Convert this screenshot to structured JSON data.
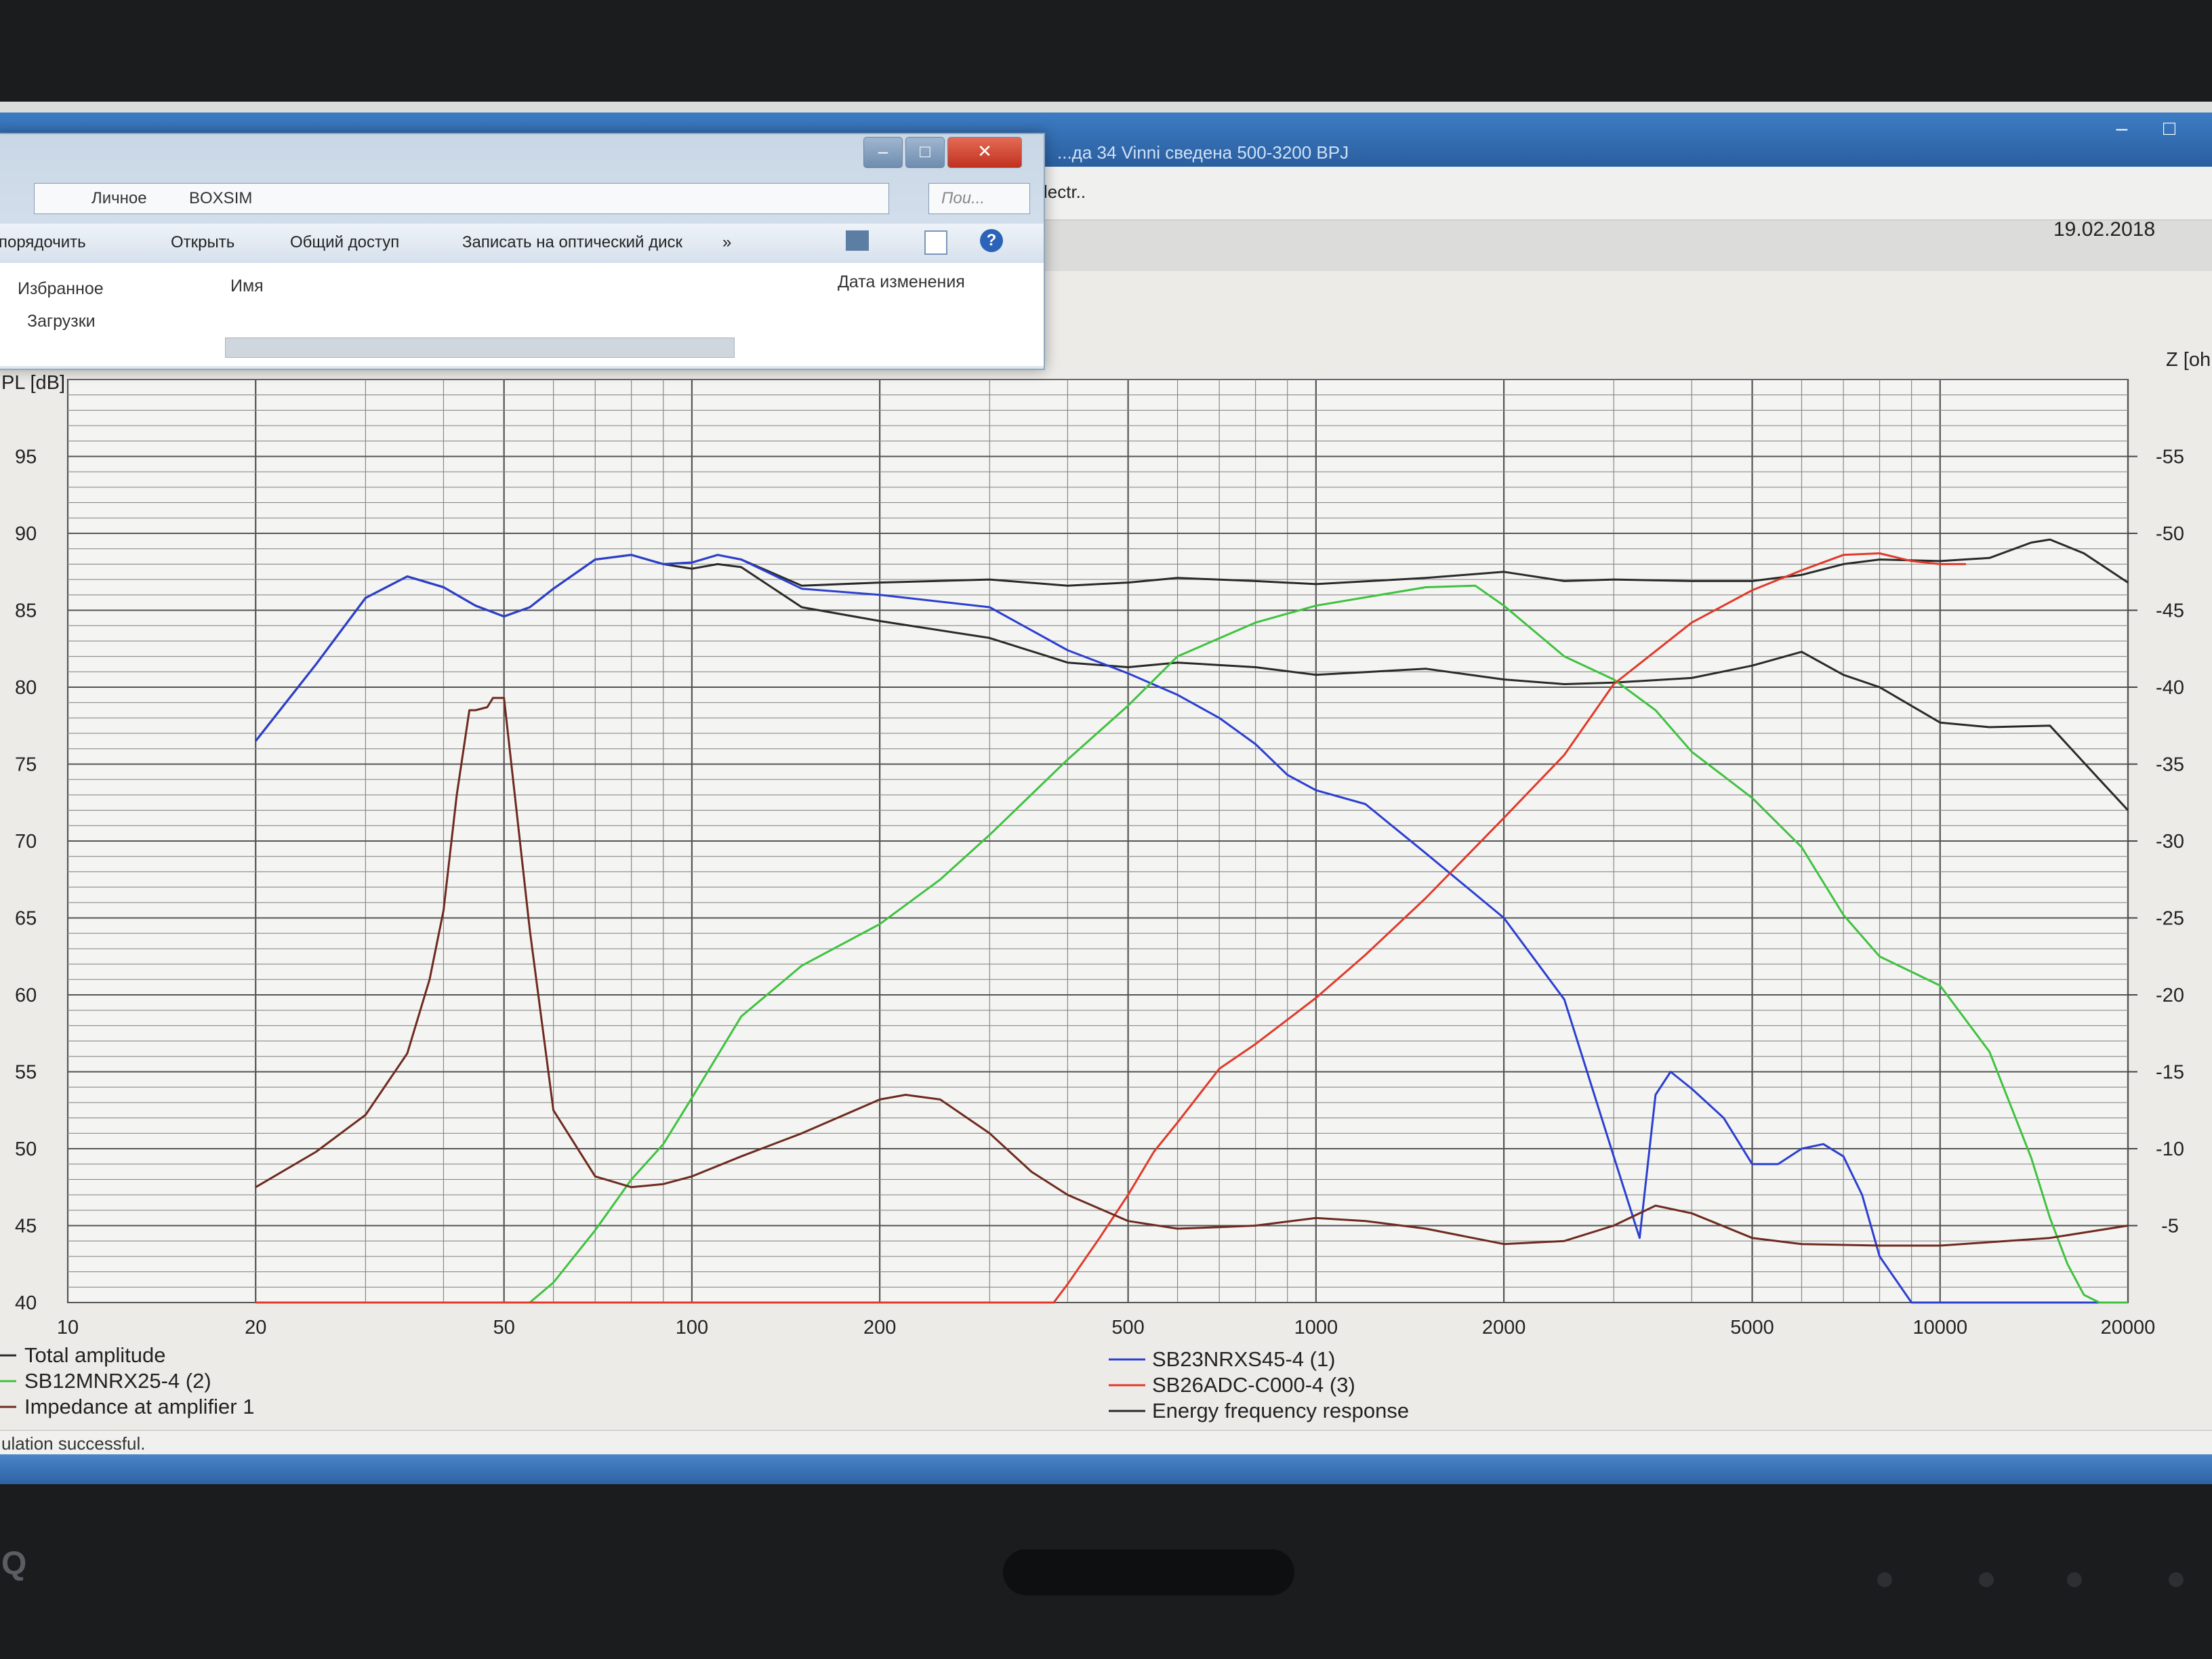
{
  "app": {
    "title": "...да 34 Vinni сведена 500-3200 BPJ",
    "menu_fragment": "lectr..",
    "status_text": "ulation successful.",
    "date": "19.02.2018"
  },
  "explorer": {
    "breadcrumb": [
      "Личное",
      "BOXSIM"
    ],
    "search_placeholder": "Пои...",
    "toolbar": {
      "organize": "порядочить",
      "open": "Открыть",
      "share": "Общий доступ",
      "burn": "Записать на оптический диск",
      "more": "»"
    },
    "nav_items": [
      "Избранное",
      "Загрузки"
    ],
    "columns": [
      "Имя",
      "Дата изменения"
    ],
    "buttons": {
      "minimize": "–",
      "maximize": "□",
      "close": "✕"
    }
  },
  "chart_data": {
    "type": "line",
    "xscale": "log",
    "xlim": [
      10,
      20000
    ],
    "ylim": [
      40,
      100
    ],
    "y2lim": [
      0,
      60
    ],
    "ylabel": "PL [dB]",
    "y2label": "Z [oh",
    "x_ticks": [
      10,
      20,
      50,
      100,
      200,
      500,
      1000,
      2000,
      5000,
      10000,
      20000
    ],
    "y_ticks": [
      40,
      45,
      50,
      55,
      60,
      65,
      70,
      75,
      80,
      85,
      90,
      95
    ],
    "y2_ticks": [
      5,
      10,
      15,
      20,
      25,
      30,
      35,
      40,
      45,
      50,
      55
    ],
    "grid": true,
    "legend": {
      "left": [
        "Total amplitude",
        "SB12MNRX25-4 (2)",
        "Impedance at amplifier 1"
      ],
      "right": [
        "SB23NRXS45-4 (1)",
        "SB26ADC-C000-4 (3)",
        "Energy frequency response"
      ]
    },
    "series": [
      {
        "name": "Total amplitude",
        "color": "#2a2a2a",
        "axis": "left",
        "x": [
          20,
          25,
          30,
          35,
          40,
          45,
          50,
          55,
          60,
          70,
          80,
          90,
          100,
          110,
          120,
          150,
          200,
          300,
          400,
          500,
          600,
          800,
          1000,
          1500,
          2000,
          2500,
          3000,
          4000,
          5000,
          6000,
          7000,
          8000,
          10000,
          12000,
          15000,
          18000,
          20000
        ],
        "y": [
          76.5,
          81.5,
          85.8,
          87.2,
          86.5,
          85.3,
          84.6,
          85.2,
          86.4,
          88.3,
          88.6,
          88,
          87.7,
          88,
          87.8,
          85.2,
          84.3,
          83.2,
          81.6,
          81.3,
          81.6,
          81.3,
          80.8,
          81.2,
          80.5,
          80.2,
          80.3,
          80.6,
          81.4,
          82.3,
          80.8,
          80,
          77.7,
          77.4,
          77.5,
          74,
          72
        ]
      },
      {
        "name": "Energy frequency response",
        "color": "#2a2a2a",
        "axis": "left",
        "x": [
          20,
          25,
          30,
          35,
          40,
          45,
          50,
          55,
          60,
          70,
          80,
          90,
          100,
          110,
          120,
          150,
          200,
          300,
          400,
          500,
          600,
          800,
          1000,
          1500,
          2000,
          2500,
          3000,
          4000,
          5000,
          6000,
          7000,
          8000,
          10000,
          12000,
          14000,
          15000,
          17000,
          20000
        ],
        "y": [
          76.5,
          81.5,
          85.8,
          87.2,
          86.5,
          85.3,
          84.6,
          85.2,
          86.4,
          88.3,
          88.6,
          88,
          88.1,
          88.6,
          88.3,
          86.6,
          86.8,
          87,
          86.6,
          86.8,
          87.1,
          86.9,
          86.7,
          87.1,
          87.5,
          86.9,
          87,
          86.9,
          86.9,
          87.3,
          88,
          88.3,
          88.2,
          88.4,
          89.4,
          89.6,
          88.7,
          86.8
        ]
      },
      {
        "name": "SB23NRXS45-4 (1)",
        "color": "#2b3fd0",
        "axis": "left",
        "x": [
          20,
          25,
          30,
          35,
          40,
          45,
          50,
          55,
          60,
          70,
          80,
          90,
          100,
          110,
          120,
          150,
          200,
          300,
          400,
          500,
          600,
          700,
          800,
          900,
          1000,
          1200,
          1500,
          2000,
          2500,
          3000,
          3300,
          3500,
          3700,
          4000,
          4500,
          5000,
          5500,
          6000,
          6500,
          7000,
          7500,
          8000,
          9000,
          10000,
          11000,
          12000,
          14000,
          16000,
          18000,
          20000
        ],
        "y": [
          76.5,
          81.5,
          85.8,
          87.2,
          86.5,
          85.3,
          84.6,
          85.2,
          86.4,
          88.3,
          88.6,
          88,
          88.1,
          88.6,
          88.3,
          86.4,
          86,
          85.2,
          82.4,
          80.9,
          79.5,
          78,
          76.3,
          74.3,
          73.3,
          72.4,
          69.2,
          65,
          59.7,
          49.5,
          44.2,
          53.5,
          55,
          53.9,
          52,
          49,
          49,
          50,
          50.3,
          49.5,
          47,
          43,
          40,
          40,
          40,
          40,
          40,
          40,
          40,
          40
        ]
      },
      {
        "name": "SB12MNRX25-4 (2)",
        "color": "#3fc23f",
        "axis": "left",
        "x": [
          20,
          55,
          60,
          70,
          80,
          90,
          100,
          120,
          150,
          200,
          250,
          300,
          400,
          500,
          600,
          800,
          1000,
          1500,
          1800,
          2000,
          2500,
          3000,
          3500,
          4000,
          5000,
          6000,
          7000,
          8000,
          9000,
          10000,
          12000,
          14000,
          15000,
          16000,
          17000,
          18000,
          20000
        ],
        "y": [
          40,
          40,
          41.3,
          44.7,
          48,
          50.3,
          53.3,
          58.6,
          61.9,
          64.6,
          67.5,
          70.4,
          75.3,
          78.8,
          82,
          84.2,
          85.3,
          86.5,
          86.6,
          85.3,
          82,
          80.5,
          78.5,
          75.8,
          72.8,
          69.6,
          65.2,
          62.5,
          61.5,
          60.6,
          56.3,
          49.4,
          45.5,
          42.5,
          40.5,
          40,
          40
        ]
      },
      {
        "name": "SB26ADC-C000-4 (3)",
        "color": "#e03a2a",
        "axis": "left",
        "x": [
          20,
          380,
          400,
          450,
          500,
          550,
          600,
          700,
          800,
          1000,
          1200,
          1500,
          2000,
          2500,
          3000,
          4000,
          5000,
          6000,
          7000,
          8000,
          9000,
          10000,
          11000
        ],
        "y": [
          40,
          40,
          41.2,
          44.2,
          47,
          49.8,
          51.7,
          55.2,
          56.8,
          59.8,
          62.6,
          66.3,
          71.5,
          75.6,
          80.2,
          84.2,
          86.3,
          87.6,
          88.6,
          88.7,
          88.2,
          88,
          88
        ]
      },
      {
        "name": "Impedance at amplifier 1",
        "color": "#6e2a1e",
        "axis": "right",
        "x": [
          20,
          25,
          30,
          35,
          38,
          40,
          42,
          44,
          45,
          47,
          48,
          50,
          55,
          60,
          70,
          80,
          90,
          100,
          120,
          150,
          200,
          220,
          250,
          300,
          350,
          400,
          500,
          600,
          700,
          800,
          1000,
          1200,
          1500,
          2000,
          2500,
          3000,
          3500,
          4000,
          5000,
          6000,
          8000,
          10000,
          15000,
          20000
        ],
        "y": [
          7.5,
          9.8,
          12.2,
          16.2,
          21,
          25.5,
          33,
          38.5,
          38.5,
          38.7,
          39.3,
          39.3,
          24.2,
          12.5,
          8.2,
          7.5,
          7.7,
          8.2,
          9.5,
          11,
          13.2,
          13.5,
          13.2,
          11,
          8.5,
          7,
          5.3,
          4.8,
          4.9,
          5,
          5.5,
          5.3,
          4.8,
          3.8,
          4,
          5,
          6.3,
          5.8,
          4.2,
          3.8,
          3.7,
          3.7,
          4.2,
          5
        ]
      }
    ]
  }
}
